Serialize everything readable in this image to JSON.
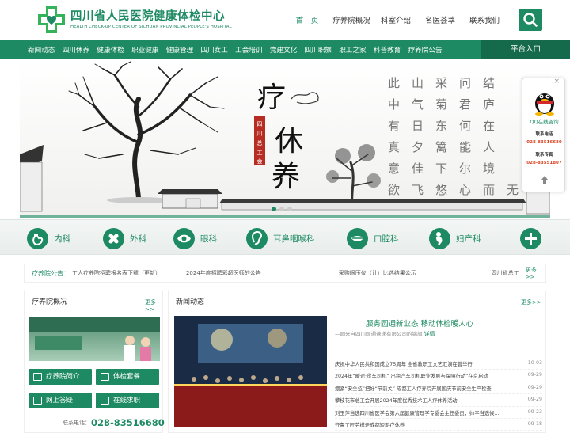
{
  "header": {
    "logo_cn": "四川省人民医院健康体检中心",
    "logo_en": "HEALTH CHECK-UP CENTER OF SICHUAN PROVINCIAL PEOPLE'S HOSPITAL",
    "topnav": [
      "首　页",
      "疗养院概况",
      "科室介绍",
      "名医荟萃",
      "联系我们"
    ],
    "search_icon": "search-icon"
  },
  "mainnav": {
    "items": [
      "新闻动态",
      "四川休养",
      "健康体检",
      "职业健康",
      "健康管理",
      "四川女工",
      "工会培训",
      "党建文化",
      "四川职旅",
      "职工之家",
      "科普教育",
      "疗养院公告"
    ],
    "platform": "平台入口"
  },
  "banner": {
    "title": "疗休养",
    "vertical_stamp": "四川省总工会",
    "poem_cols": [
      "结庐在人境",
      "而无车马喧",
      "问君何能尔",
      "心远地自偏",
      "采菊东篱下",
      "悠然见南山",
      "山气日夕佳",
      "飞鸟相与还",
      "此中有真意",
      "欲辨已忘言"
    ]
  },
  "float_service": {
    "qq_label": "QQ在线咨询",
    "tel_label": "联系电话",
    "tel": "028-83516680",
    "fax_label": "联系传真",
    "fax": "028-83551807"
  },
  "departments": [
    {
      "name": "内科",
      "icon": "stomach-icon"
    },
    {
      "name": "外科",
      "icon": "bandage-icon"
    },
    {
      "name": "眼科",
      "icon": "eye-icon"
    },
    {
      "name": "耳鼻咽喉科",
      "icon": "ear-icon"
    },
    {
      "name": "口腔科",
      "icon": "mouth-icon"
    },
    {
      "name": "妇产科",
      "icon": "female-icon"
    },
    {
      "name": "",
      "icon": "plus-icon"
    }
  ],
  "notice": {
    "head": "疗养院公告：",
    "items": [
      "工人疗养院招聘报名表下载（更新）",
      "2024年度招聘彩超医师的公告",
      "采购眼压仪（计）比选结果公示",
      "四川省总工"
    ],
    "more": "更多>>"
  },
  "intro": {
    "title": "疗养院概况",
    "more": "更多>>",
    "buttons": [
      "疗养院简介",
      "体检套餐",
      "网上答疑",
      "在线求职"
    ],
    "phone_label": "联系电话：",
    "phone": "028-83516680"
  },
  "news": {
    "title": "新闻动态",
    "more": "更多>>",
    "headline": "服务圆通新业态 移动体检暖人心",
    "sub": "—圆来自四川圆通速递有限公司的锦旗",
    "sub_link": "详情",
    "items": [
      {
        "t": "庆祝中华人民共和国成立75周年 全省教职工文艺汇演在蓉举行",
        "d": "10-03"
      },
      {
        "t": "2024年“暖途·货车司机” 出租汽车司机职业发展与保障行动”在京启动",
        "d": "09-29"
      },
      {
        "t": "绷紧“安全弦”把好“节前关” 成都工人疗养院开展国庆节前安全生产检查",
        "d": "09-29"
      },
      {
        "t": "攀枝花市总工会开展2024年度优秀技术工人疗休养活动",
        "d": "09-29"
      },
      {
        "t": "刘玉萍当选四川省医学会第六届健康管理学专委会主任委员，帅平当选候...",
        "d": "09-23"
      },
      {
        "t": "齐鲁工匠劳模走成都短期疗休养",
        "d": "09-18"
      }
    ]
  }
}
